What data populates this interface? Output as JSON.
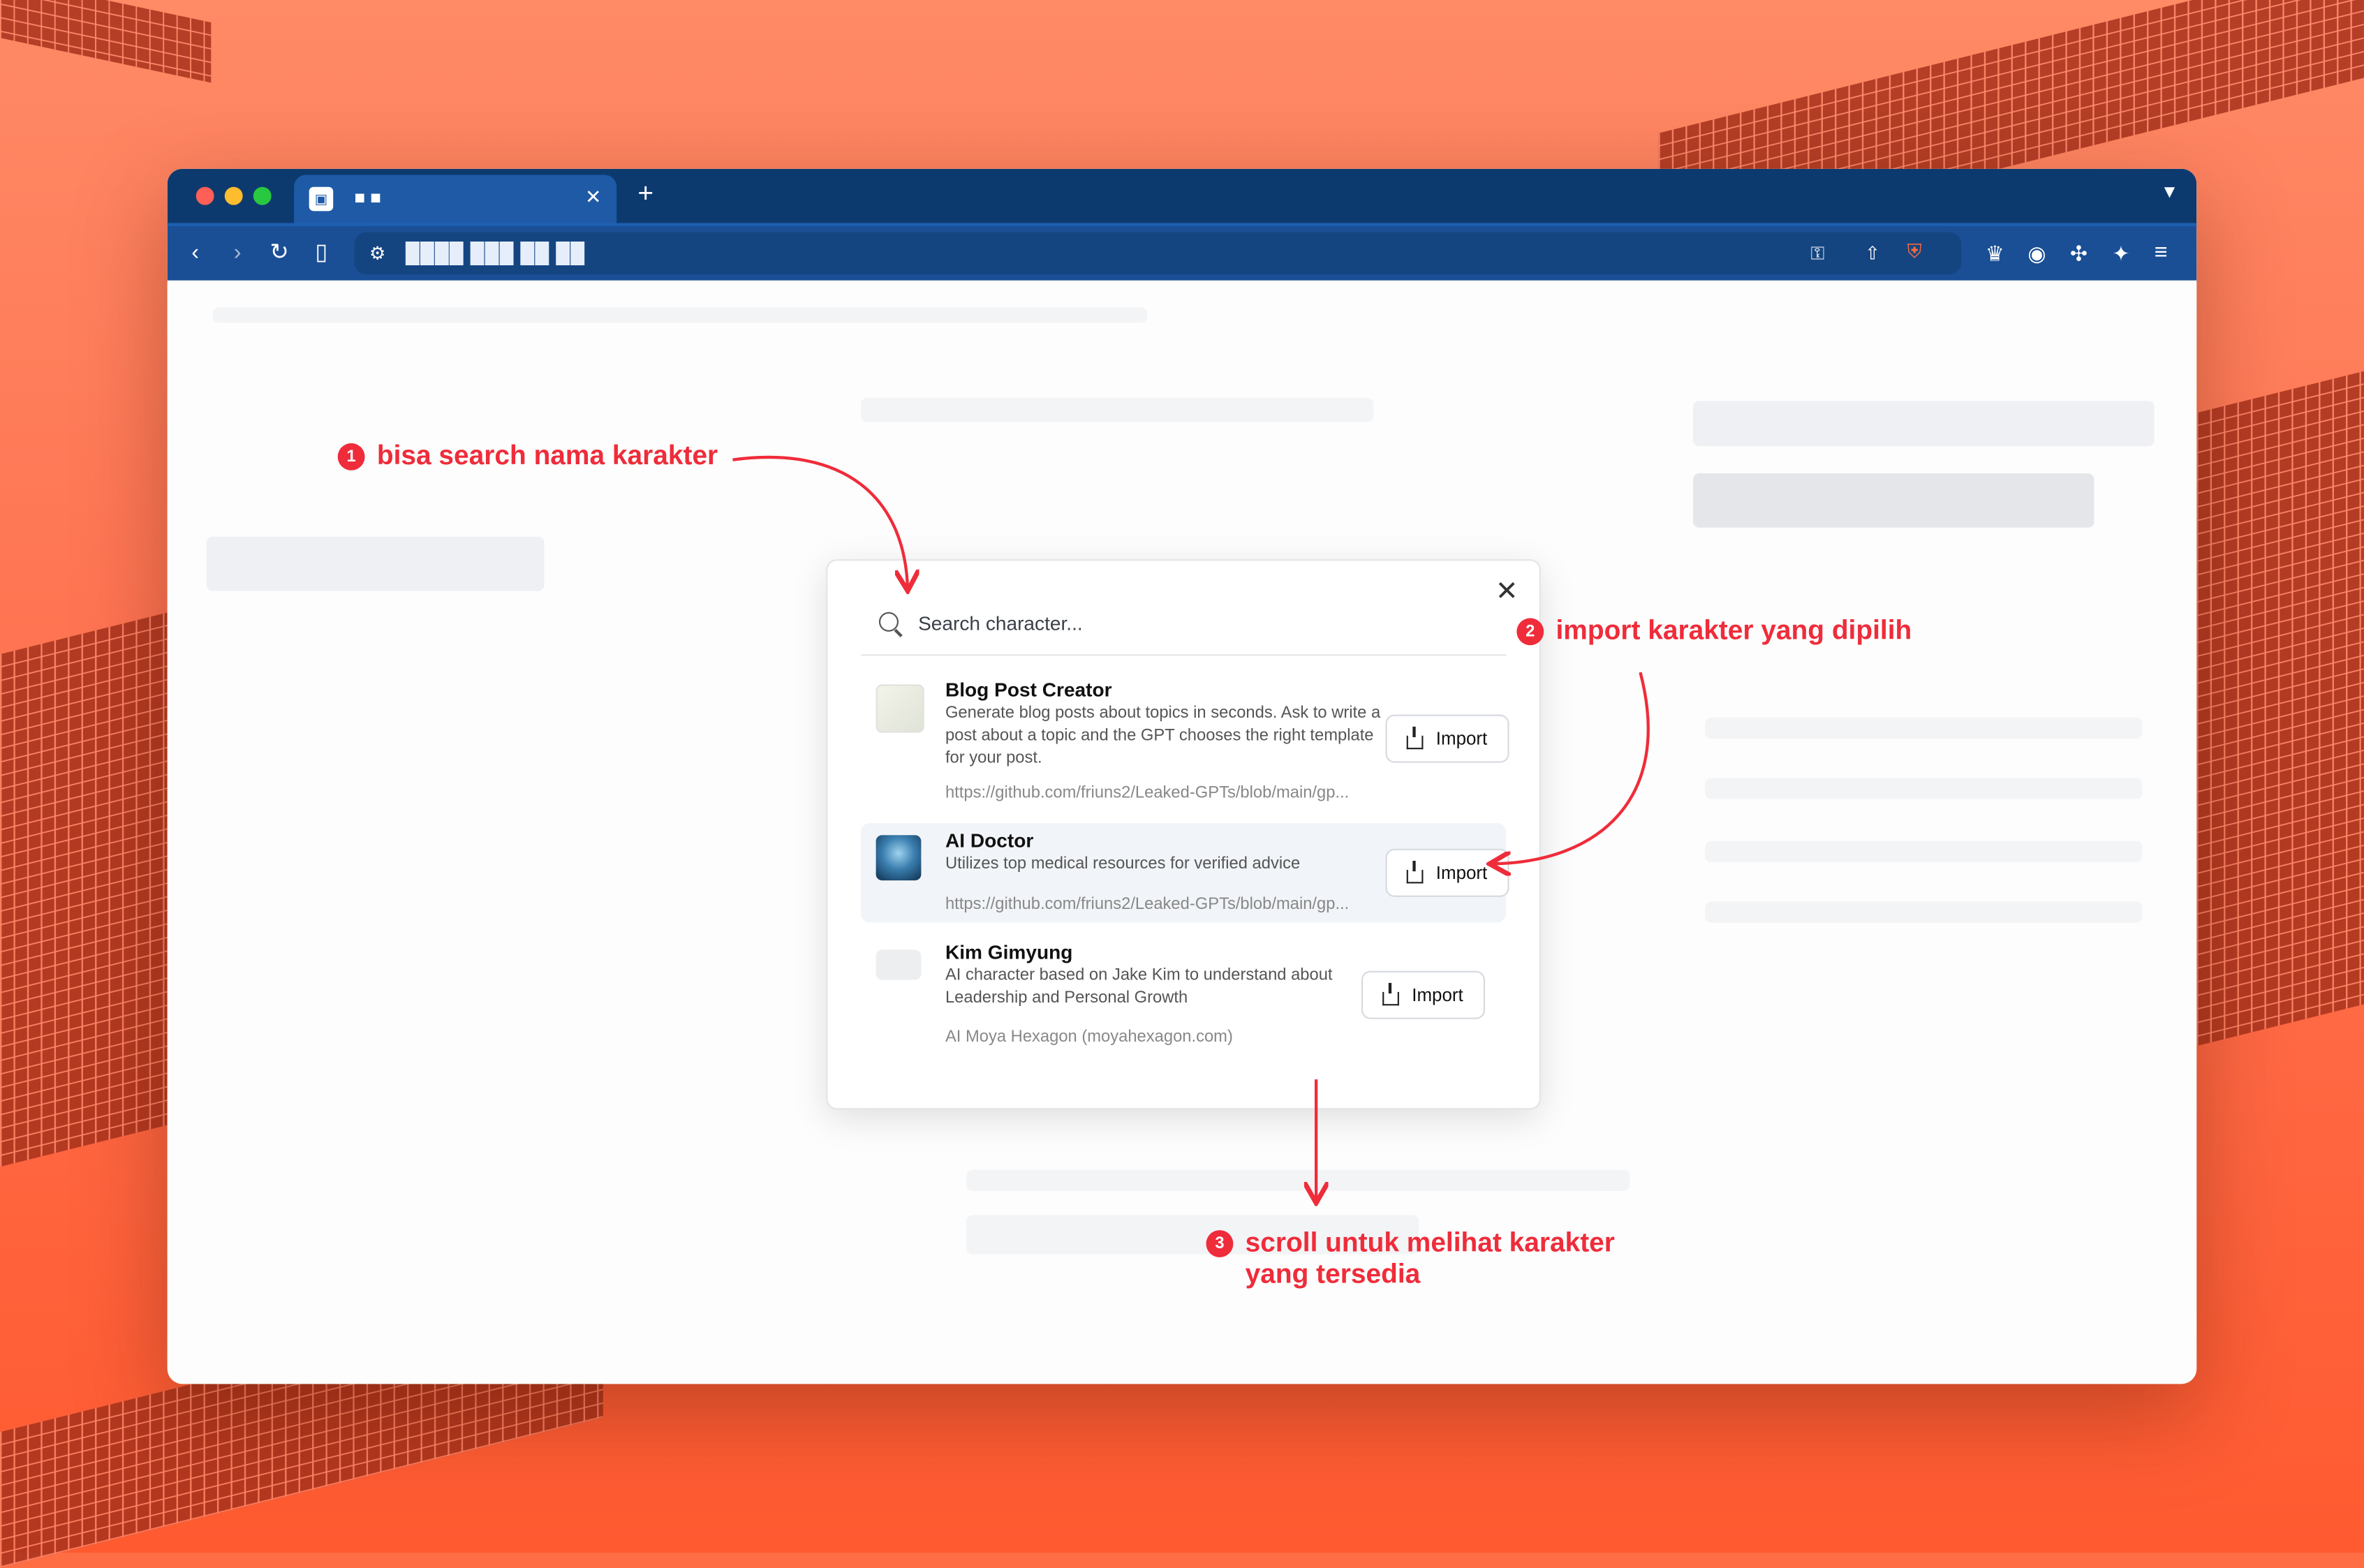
{
  "browser": {
    "tab_title": "■ ■",
    "tab_favicon": "▣",
    "url": "████ ███ ██ ██"
  },
  "modal": {
    "search_placeholder": "Search character...",
    "items": [
      {
        "name": "Blog Post Creator",
        "description": "Generate blog posts about topics in seconds. Ask to write a post about a topic and the GPT chooses the right template for your post.",
        "link": "https://github.com/friuns2/Leaked-GPTs/blob/main/gp...",
        "button": "Import"
      },
      {
        "name": "AI Doctor",
        "description": "Utilizes top medical resources for verified advice",
        "link": "https://github.com/friuns2/Leaked-GPTs/blob/main/gp...",
        "button": "Import"
      },
      {
        "name": "Kim Gimyung",
        "description": "AI character based on Jake Kim to understand about Leadership and Personal Growth",
        "link": "AI Moya Hexagon (moyahexagon.com)",
        "button": "Import"
      }
    ]
  },
  "annotations": {
    "a1_num": "1",
    "a1_text": "bisa search nama karakter",
    "a2_num": "2",
    "a2_text": "import karakter yang dipilih",
    "a3_num": "3",
    "a3_line1": "scroll untuk melihat karakter",
    "a3_line2": "yang tersedia"
  },
  "colors": {
    "annotation": "#ef2c3a",
    "tabbar": "#0d3a6e",
    "navbar": "#1a4f96"
  }
}
